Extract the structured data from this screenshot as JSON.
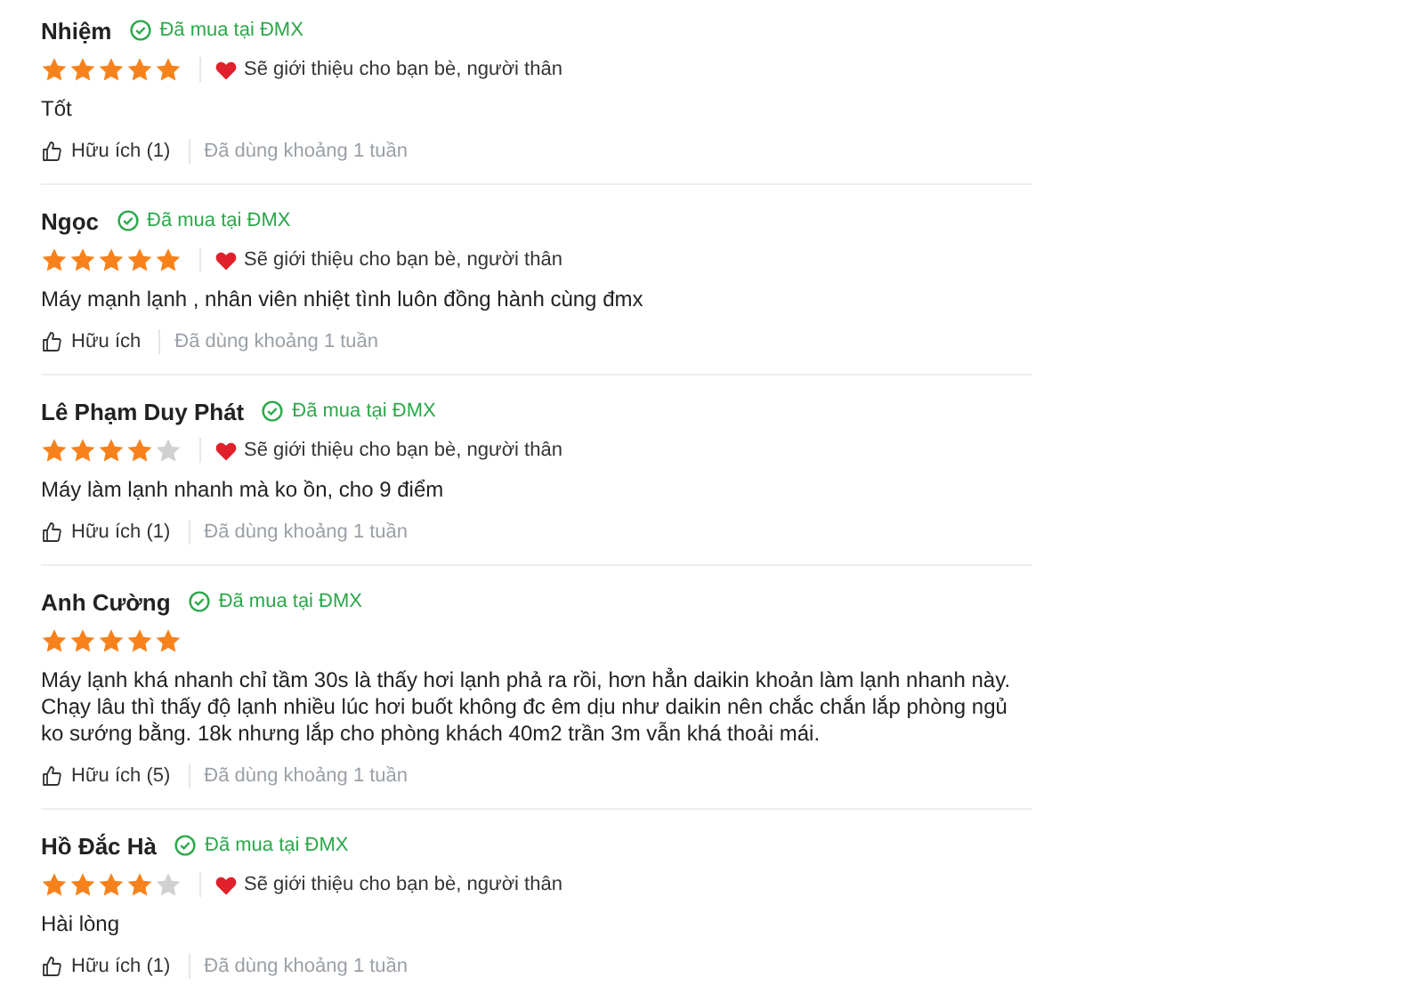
{
  "reviews": [
    {
      "name": "Nhiệm",
      "badge": "Đã mua tại ĐMX",
      "stars": 5,
      "recommend": "Sẽ giới thiệu cho bạn bè, người thân",
      "text": "Tốt",
      "helpful": "Hữu ích (1)",
      "usage": "Đã dùng khoảng 1 tuần"
    },
    {
      "name": "Ngọc",
      "badge": "Đã mua tại ĐMX",
      "stars": 5,
      "recommend": "Sẽ giới thiệu cho bạn bè, người thân",
      "text": "Máy mạnh lạnh , nhân viên nhiệt tình luôn đồng hành cùng đmx",
      "helpful": "Hữu ích",
      "usage": "Đã dùng khoảng 1 tuần"
    },
    {
      "name": "Lê Phạm Duy Phát",
      "badge": "Đã mua tại ĐMX",
      "stars": 4,
      "recommend": "Sẽ giới thiệu cho bạn bè, người thân",
      "text": "Máy làm lạnh nhanh mà ko ồn, cho 9 điểm",
      "helpful": "Hữu ích (1)",
      "usage": "Đã dùng khoảng 1 tuần"
    },
    {
      "name": "Anh Cường",
      "badge": "Đã mua tại ĐMX",
      "stars": 5,
      "text": "Máy lạnh khá nhanh chỉ tầm 30s là thấy hơi lạnh phả ra rồi, hơn hẳn daikin khoản làm lạnh nhanh này. Chạy lâu thì thấy độ lạnh nhiều lúc hơi buốt không đc êm dịu như daikin nên chắc chắn lắp phòng ngủ ko sướng bằng. 18k nhưng lắp cho phòng khách 40m2 trần 3m vẫn khá thoải mái.",
      "helpful": "Hữu ích (5)",
      "usage": "Đã dùng khoảng 1 tuần"
    },
    {
      "name": "Hồ Đắc Hà",
      "badge": "Đã mua tại ĐMX",
      "stars": 4,
      "recommend": "Sẽ giới thiệu cho bạn bè, người thân",
      "text": "Hài lòng",
      "helpful": "Hữu ích (1)",
      "usage": "Đã dùng khoảng 1 tuần"
    }
  ]
}
